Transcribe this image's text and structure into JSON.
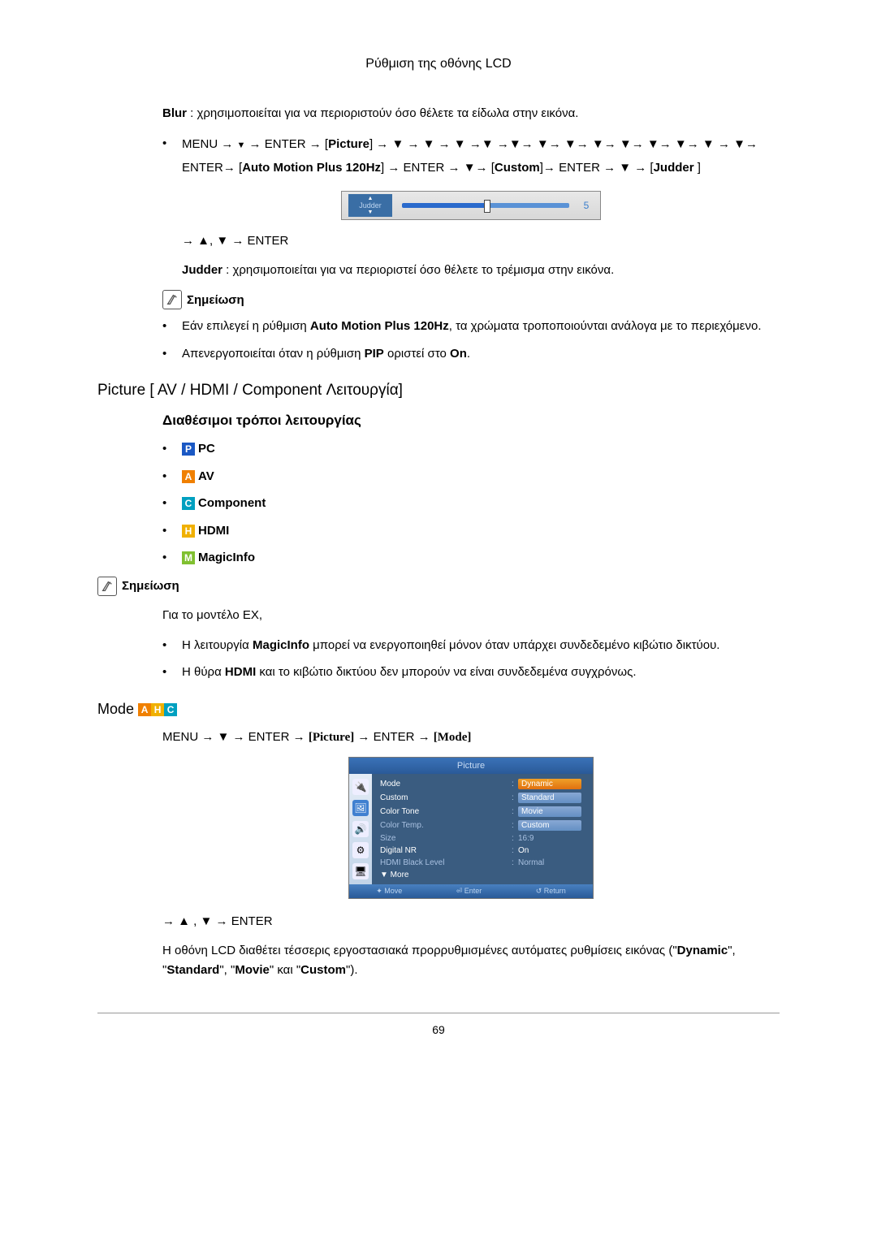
{
  "header": {
    "title": "Ρύθμιση της οθόνης LCD"
  },
  "blur_line": {
    "label": "Blur",
    "rest": " : χρησιμοποιείται για να περιοριστούν όσο θέλετε τα είδωλα στην εικόνα."
  },
  "menu_path_1": {
    "pre": "MENU → ",
    "enter": " → ENTER → [",
    "picture": "Picture",
    "arrows": "] → ▼ → ▼ → ▼ →▼ →▼→ ▼→ ▼→ ▼→ ▼→ ▼→ ▼→ ▼ → ▼→ ENTER→ [",
    "amp": "Auto Motion Plus 120Hz",
    "rest1": "]  → ENTER → ▼→ [",
    "custom": "Custom",
    "rest2": "]→ ENTER → ▼ → [",
    "judder": "Judder",
    "rest3": " ]"
  },
  "slider": {
    "name": "Judder",
    "value": "5"
  },
  "after_slider": "→ ▲, ▼ → ENTER",
  "judder_line": {
    "label": "Judder",
    "rest": " : χρησιμοποιείται για να περιοριστεί όσο θέλετε το τρέμισμα στην εικόνα."
  },
  "note1_label": "Σημείωση",
  "note1_items": [
    {
      "pre": "Εάν επιλεγεί η ρύθμιση ",
      "b1": "Auto Motion Plus 120Hz",
      "rest": ", τα χρώματα τροποποιούνται ανάλογα με το περιεχόμενο."
    },
    {
      "pre": "Απενεργοποιείται όταν η ρύθμιση ",
      "b1": "PIP",
      "mid": " οριστεί στο ",
      "b2": "On",
      "rest": "."
    }
  ],
  "h2_picture": "Picture [ AV / HDMI / Component Λειτουργία]",
  "h3_modes": "Διαθέσιμοι τρόποι λειτουργίας",
  "modes": [
    {
      "letter": "P",
      "css": "mi-P",
      "label": "PC"
    },
    {
      "letter": "A",
      "css": "mi-A",
      "label": "AV"
    },
    {
      "letter": "C",
      "css": "mi-C",
      "label": "Component"
    },
    {
      "letter": "H",
      "css": "mi-H",
      "label": "HDMI"
    },
    {
      "letter": "M",
      "css": "mi-M",
      "label": "MagicInfo"
    }
  ],
  "note2_label": "Σημείωση",
  "note2_pre": "Για το μοντέλο EX,",
  "note2_items": [
    {
      "pre": "Η λειτουργία ",
      "b1": "MagicInfo",
      "rest": " μπορεί να ενεργοποιηθεί μόνον όταν υπάρχει συνδεδεμένο κιβώτιο δικτύου."
    },
    {
      "pre": "Η θύρα ",
      "b1": "HDMI",
      "rest": " και το κιβώτιο δικτύου δεν μπορούν να είναι συνδεδεμένα συγχρόνως."
    }
  ],
  "h2_mode": "Mode",
  "mode_path": {
    "a": "MENU → ▼ → ENTER → ",
    "picture": "[Picture]",
    "b": " → ENTER → ",
    "mode": "[Mode]"
  },
  "menu_shot": {
    "title": "Picture",
    "rows": [
      {
        "k": "Mode",
        "v": "Dynamic",
        "hot": true,
        "bright": true
      },
      {
        "k": "Custom",
        "v": "Standard",
        "box": true,
        "bright": true
      },
      {
        "k": "Color Tone",
        "v": "Movie",
        "box": true,
        "bright": true
      },
      {
        "k": "Color Temp.",
        "v": "Custom",
        "box": true,
        "bright": false
      },
      {
        "k": "Size",
        "v": "16:9",
        "bright": false
      },
      {
        "k": "Digital NR",
        "v": "On",
        "bright": true
      },
      {
        "k": "HDMI Black Level",
        "v": "Normal",
        "bright": false
      }
    ],
    "more": "More",
    "footer": {
      "move": "Move",
      "enter": "Enter",
      "return": "Return"
    }
  },
  "after_menu": "→ ▲ , ▼ → ENTER",
  "final_para": {
    "pre": "Η οθόνη LCD διαθέτει τέσσερις εργοστασιακά προρρυθμισμένες αυτόματες ρυθμίσεις εικόνας (\"",
    "b1": "Dynamic",
    "c1": "\", \"",
    "b2": "Standard",
    "c2": "\", \"",
    "b3": "Movie",
    "c3": "\" και \"",
    "b4": "Custom",
    "c4": "\")."
  },
  "page_num": "69"
}
